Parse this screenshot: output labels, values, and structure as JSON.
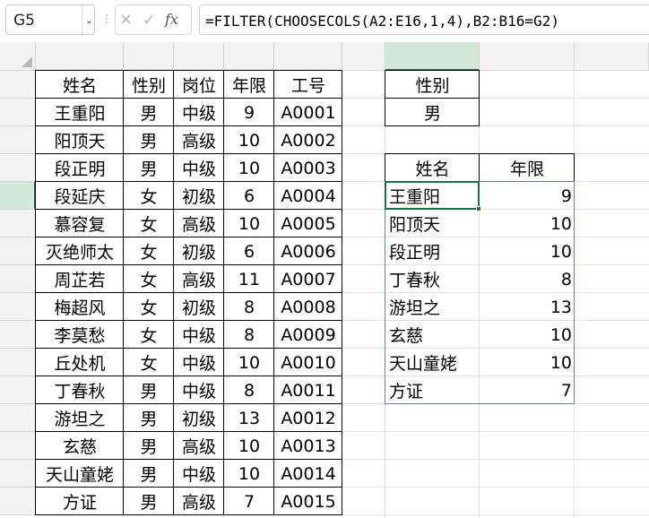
{
  "name_box": {
    "value": "G5"
  },
  "formula_bar": {
    "cancel_glyph": "✕",
    "enter_glyph": "✓",
    "fx_glyph": "fx",
    "formula": "=FILTER(CHOOSECOLS(A2:E16,1,4),B2:B16=G2)"
  },
  "columns": [
    "A",
    "B",
    "C",
    "D",
    "E",
    "F",
    "G",
    "H",
    "I"
  ],
  "rows": [
    "1",
    "2",
    "3",
    "4",
    "5",
    "6",
    "7",
    "8",
    "9",
    "10",
    "11",
    "12",
    "13",
    "14",
    "15",
    "16"
  ],
  "active_cell": {
    "column": "G",
    "row": "5"
  },
  "source_table": {
    "headers": [
      "姓名",
      "性别",
      "岗位",
      "年限",
      "工号"
    ],
    "rows": [
      [
        "王重阳",
        "男",
        "中级",
        "9",
        "A0001"
      ],
      [
        "阳顶天",
        "男",
        "高级",
        "10",
        "A0002"
      ],
      [
        "段正明",
        "男",
        "中级",
        "10",
        "A0003"
      ],
      [
        "段延庆",
        "女",
        "初级",
        "6",
        "A0004"
      ],
      [
        "慕容复",
        "女",
        "高级",
        "10",
        "A0005"
      ],
      [
        "灭绝师太",
        "女",
        "初级",
        "6",
        "A0006"
      ],
      [
        "周芷若",
        "女",
        "高级",
        "11",
        "A0007"
      ],
      [
        "梅超风",
        "女",
        "初级",
        "8",
        "A0008"
      ],
      [
        "李莫愁",
        "女",
        "中级",
        "8",
        "A0009"
      ],
      [
        "丘处机",
        "女",
        "中级",
        "10",
        "A0010"
      ],
      [
        "丁春秋",
        "男",
        "中级",
        "8",
        "A0011"
      ],
      [
        "游坦之",
        "男",
        "初级",
        "13",
        "A0012"
      ],
      [
        "玄慈",
        "男",
        "高级",
        "10",
        "A0013"
      ],
      [
        "天山童姥",
        "男",
        "中级",
        "10",
        "A0014"
      ],
      [
        "方证",
        "男",
        "高级",
        "7",
        "A0015"
      ]
    ]
  },
  "criteria": {
    "header": "性别",
    "value": "男"
  },
  "result_table": {
    "headers": [
      "姓名",
      "年限"
    ],
    "rows": [
      [
        "王重阳",
        "9"
      ],
      [
        "阳顶天",
        "10"
      ],
      [
        "段正明",
        "10"
      ],
      [
        "丁春秋",
        "8"
      ],
      [
        "游坦之",
        "13"
      ],
      [
        "玄慈",
        "10"
      ],
      [
        "天山童姥",
        "10"
      ],
      [
        "方证",
        "7"
      ]
    ]
  }
}
